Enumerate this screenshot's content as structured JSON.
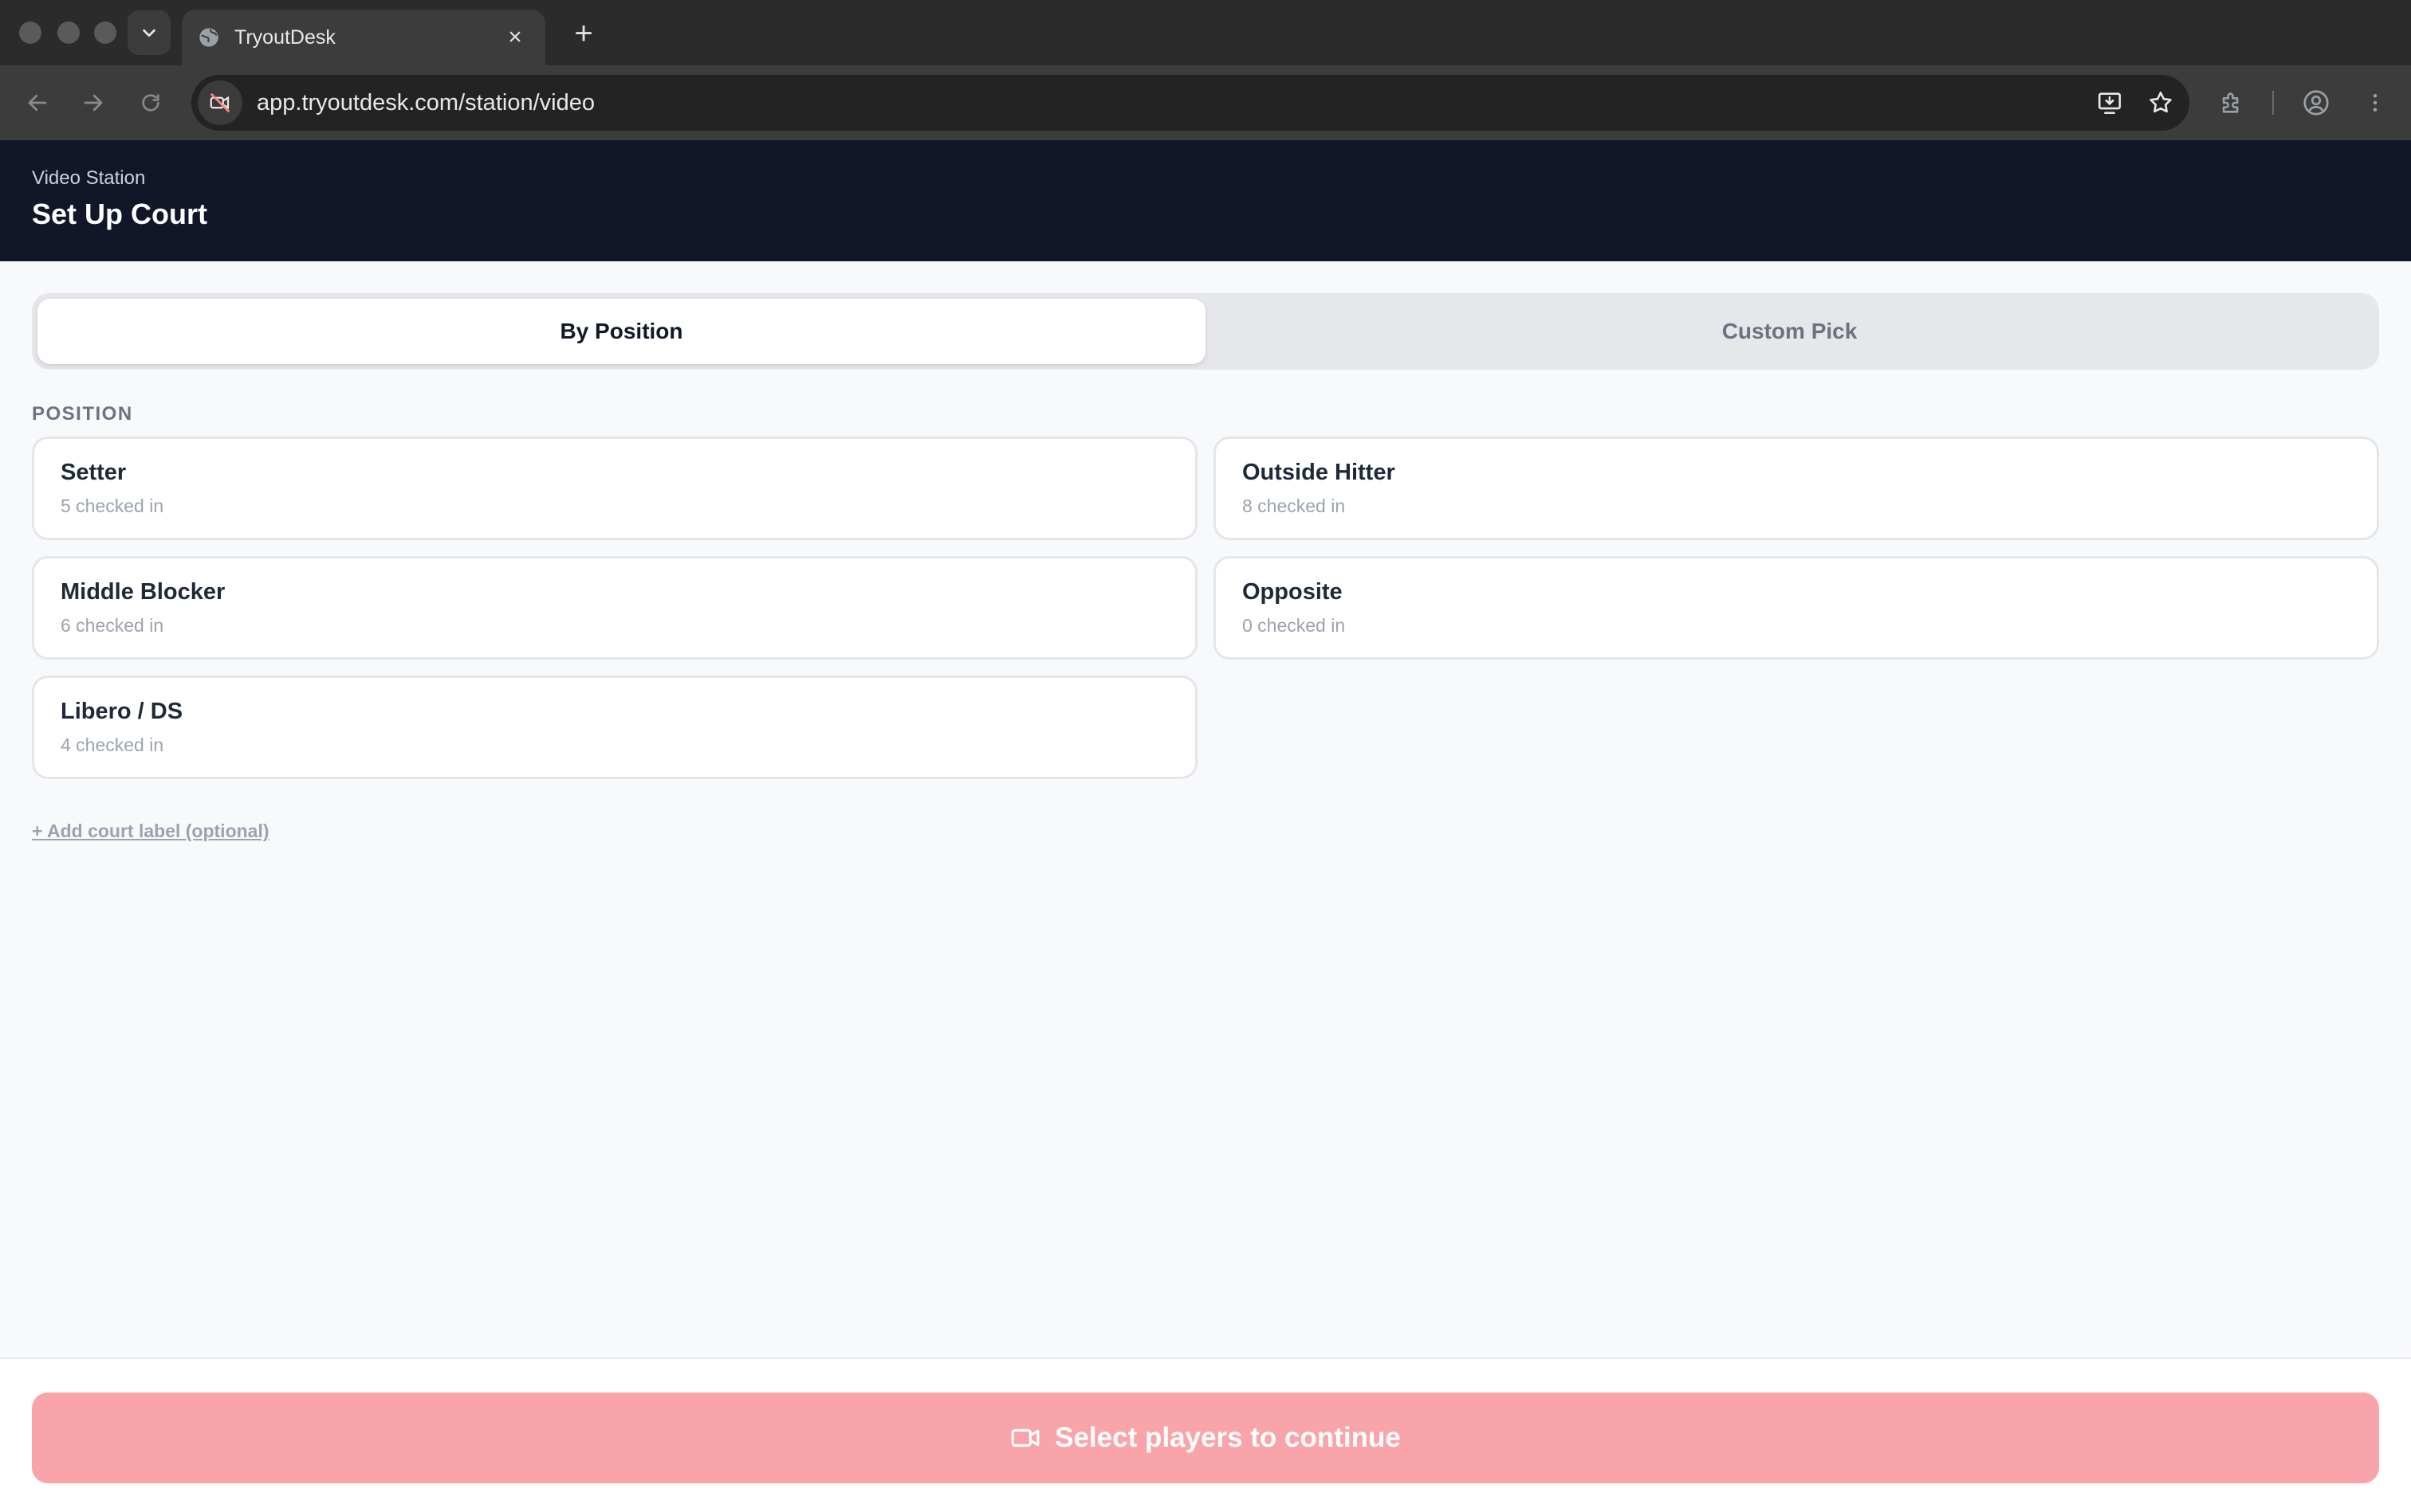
{
  "browser": {
    "tab_title": "TryoutDesk",
    "url": "app.tryoutdesk.com/station/video"
  },
  "header": {
    "subtitle": "Video Station",
    "title": "Set Up Court"
  },
  "mode_tabs": [
    {
      "label": "By Position",
      "active": true
    },
    {
      "label": "Custom Pick",
      "active": false
    }
  ],
  "section_label": "POSITION",
  "positions": [
    {
      "name": "Setter",
      "count": "5 checked in"
    },
    {
      "name": "Outside Hitter",
      "count": "8 checked in"
    },
    {
      "name": "Middle Blocker",
      "count": "6 checked in"
    },
    {
      "name": "Opposite",
      "count": "0 checked in"
    },
    {
      "name": "Libero / DS",
      "count": "4 checked in"
    }
  ],
  "add_court_label": "+ Add court label (optional)",
  "cta": {
    "label": "Select players to continue",
    "icon": "video-camera-icon",
    "color": "#f9a4a8"
  },
  "colors": {
    "header_bg": "#111729",
    "page_bg": "#f8f9fb"
  }
}
